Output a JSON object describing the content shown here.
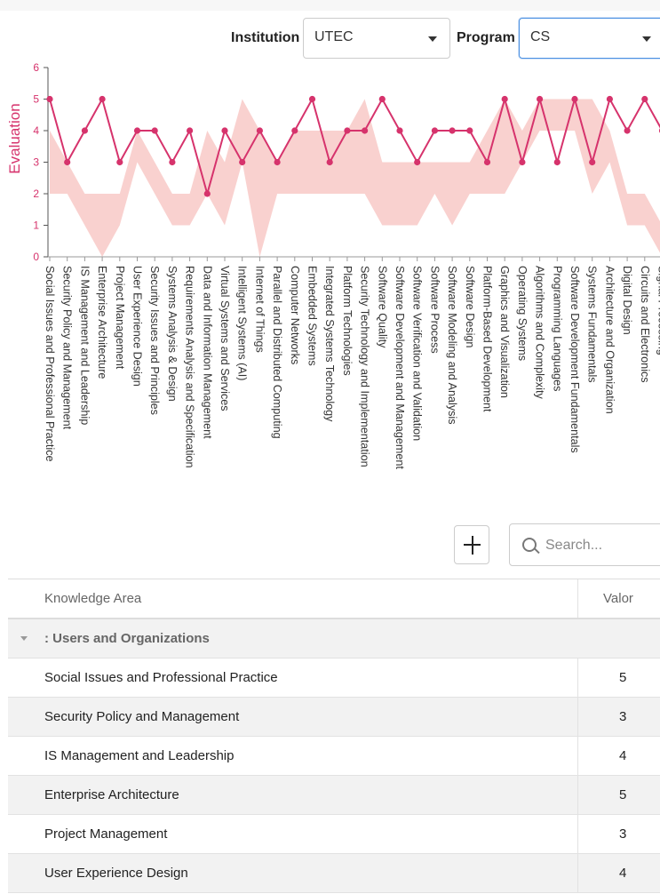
{
  "filters": {
    "institution_label": "Institution",
    "institution_value": "UTEC",
    "program_label": "Program",
    "program_value": "CS"
  },
  "chart_data": {
    "type": "line",
    "ylabel": "Evaluation",
    "ylim": [
      0,
      6
    ],
    "yticks": [
      0,
      1,
      2,
      3,
      4,
      5,
      6
    ],
    "categories": [
      "Social Issues and Professional Practice",
      "Security Policy and Management",
      "IS Management and Leadership",
      "Enterprise Architecture",
      "Project Management",
      "User Experience Design",
      "Security Issues and Principles",
      "Systems Analysis & Design",
      "Requirements Analysis and Specification",
      "Data and Information Management",
      "Virtual Systems and Services",
      "Intelligent Systems (AI)",
      "Internet of Things",
      "Parallel and Distributed Computing",
      "Computer Networks",
      "Embedded Systems",
      "Integrated Systems Technology",
      "Platform Technologies",
      "Security Technology and Implementation",
      "Software Quality",
      "Software Development and Management",
      "Software Verification and Validation",
      "Software Process",
      "Software Modeling and Analysis",
      "Software Design",
      "Platform-Based Development",
      "Graphics and Visualization",
      "Operating Systems",
      "Algorithms and Complexity",
      "Programming Languages",
      "Software Development Fundamentals",
      "Systems Fundamentals",
      "Architecture and Organization",
      "Digital Design",
      "Circuits and Electronics",
      "Signal Processing"
    ],
    "series": [
      {
        "values": [
          5,
          3,
          4,
          5,
          3,
          4,
          4,
          3,
          4,
          2,
          4,
          3,
          4,
          3,
          4,
          5,
          3,
          4,
          4,
          5,
          4,
          3,
          4,
          4,
          4,
          3,
          5,
          3,
          5,
          3,
          5,
          3,
          5,
          4,
          5,
          4
        ]
      }
    ],
    "range_band": {
      "low": [
        2,
        2,
        1,
        0,
        1,
        3,
        2,
        1,
        1,
        2,
        1,
        3,
        0,
        2,
        2,
        2,
        2,
        2,
        2,
        1,
        1,
        1,
        2,
        1,
        2,
        2,
        2,
        3,
        4,
        4,
        4,
        2,
        3,
        1,
        1,
        0
      ],
      "high": [
        4,
        3,
        2,
        2,
        2,
        4,
        3,
        2,
        2,
        4,
        3,
        5,
        4,
        3,
        4,
        4,
        4,
        4,
        5,
        3,
        3,
        3,
        3,
        3,
        3,
        4,
        5,
        4,
        5,
        5,
        5,
        5,
        4,
        2,
        2,
        1
      ]
    },
    "colors": {
      "line": "#d6336c",
      "band": "#f8c9c7",
      "axis": "#555555"
    },
    "grid": false
  },
  "toolbar": {
    "add_icon": "plus-icon",
    "search_icon": "search-icon",
    "search_placeholder": "Search..."
  },
  "table": {
    "columns": [
      "Knowledge Area",
      "Valor"
    ],
    "group": ": Users and Organizations",
    "rows": [
      {
        "area": "Social Issues and Professional Practice",
        "value": "5"
      },
      {
        "area": "Security Policy and Management",
        "value": "3"
      },
      {
        "area": "IS Management and Leadership",
        "value": "4"
      },
      {
        "area": "Enterprise Architecture",
        "value": "5"
      },
      {
        "area": "Project Management",
        "value": "3"
      },
      {
        "area": "User Experience Design",
        "value": "4"
      }
    ]
  }
}
